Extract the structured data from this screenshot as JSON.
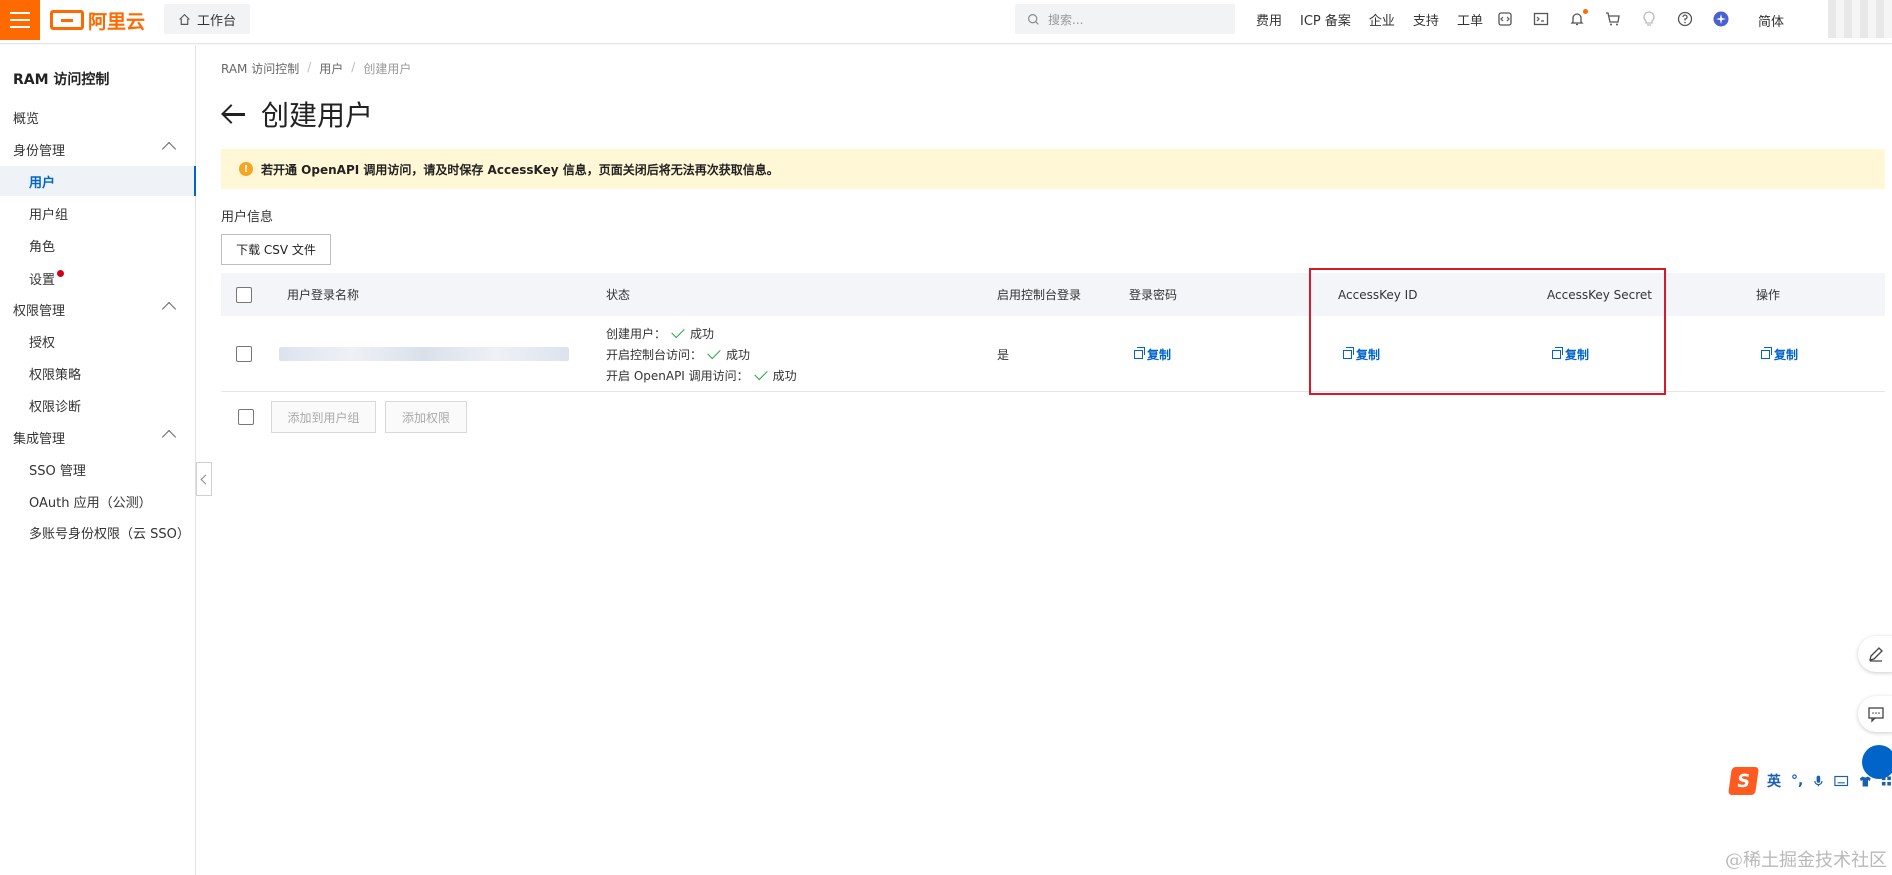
{
  "topbar": {
    "brand": "阿里云",
    "workbench": "工作台",
    "search_placeholder": "搜索...",
    "links": [
      "费用",
      "ICP 备案",
      "企业",
      "支持",
      "工单"
    ],
    "icons": [
      "code-icon",
      "terminal-icon",
      "bell-icon",
      "cart-icon",
      "bulb-icon",
      "help-icon",
      "ai-assistant-icon"
    ],
    "lang": "简体"
  },
  "sidebar": {
    "title": "RAM 访问控制",
    "items": [
      {
        "label": "概览"
      },
      {
        "label": "身份管理"
      },
      {
        "label": "用户"
      },
      {
        "label": "用户组"
      },
      {
        "label": "角色"
      },
      {
        "label": "设置"
      },
      {
        "label": "权限管理"
      },
      {
        "label": "授权"
      },
      {
        "label": "权限策略"
      },
      {
        "label": "权限诊断"
      },
      {
        "label": "集成管理"
      },
      {
        "label": "SSO 管理"
      },
      {
        "label": "OAuth 应用（公测）"
      },
      {
        "label": "多账号身份权限（云 SSO）"
      }
    ]
  },
  "breadcrumb": [
    "RAM 访问控制",
    "用户",
    "创建用户"
  ],
  "page_title": "创建用户",
  "alert": "若开通 OpenAPI 调用访问，请及时保存 AccessKey 信息，页面关闭后将无法再次获取信息。",
  "section_label": "用户信息",
  "csv_button": "下载 CSV 文件",
  "table": {
    "headers": [
      "用户登录名称",
      "状态",
      "启用控制台登录",
      "登录密码",
      "AccessKey ID",
      "AccessKey Secret",
      "操作"
    ],
    "row": {
      "status": [
        {
          "label": "创建用户：",
          "value": "成功"
        },
        {
          "label": "开启控制台访问：",
          "value": "成功"
        },
        {
          "label": "开启 OpenAPI 调用访问：",
          "value": "成功"
        }
      ],
      "console_login": "是",
      "password_action": "复制",
      "ak_id_action": "复制",
      "ak_secret_action": "复制",
      "op_action": "复制"
    }
  },
  "footer_buttons": [
    "添加到用户组",
    "添加权限"
  ],
  "ime": {
    "logo": "S",
    "lang": "英"
  },
  "watermark": "@稀土掘金技术社区",
  "colors": {
    "brand": "#ff6a00",
    "link": "#0064c8",
    "alert_bg": "#fff7d6",
    "highlight": "#d9182a",
    "success": "#2aa844"
  }
}
